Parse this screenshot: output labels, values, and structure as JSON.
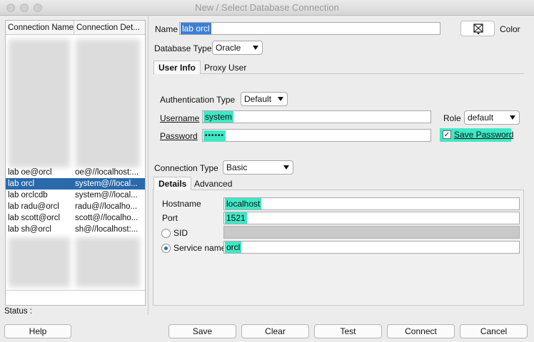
{
  "window": {
    "title": "New / Select Database Connection"
  },
  "connections": {
    "headers": [
      "Connection Name",
      "Connection Det..."
    ],
    "rows": [
      {
        "name": "lab oe@orcl",
        "details": "oe@//localhost:..."
      },
      {
        "name": "lab orcl",
        "details": "system@//local..."
      },
      {
        "name": "lab orclcdb",
        "details": "system@//local..."
      },
      {
        "name": "lab radu@orcl",
        "details": "radu@//localho..."
      },
      {
        "name": "lab scott@orcl",
        "details": "scott@//localho..."
      },
      {
        "name": "lab sh@orcl",
        "details": "sh@//localhost:..."
      }
    ],
    "selected_index": 1
  },
  "status": {
    "label": "Status :"
  },
  "form": {
    "name_label": "Name",
    "name_value": "lab orcl",
    "color_label": "Color",
    "db_type_label": "Database Type",
    "db_type_value": "Oracle",
    "tabs_top": [
      "User Info",
      "Proxy User"
    ],
    "auth_type_label": "Authentication Type",
    "auth_type_value": "Default",
    "username_label": "Username",
    "username_value": "system",
    "role_label": "Role",
    "role_value": "default",
    "password_label": "Password",
    "password_value": "••••••",
    "save_password_label": "Save Password",
    "save_password_checked": true,
    "conn_type_label": "Connection Type",
    "conn_type_value": "Basic",
    "tabs_bottom": [
      "Details",
      "Advanced"
    ],
    "hostname_label": "Hostname",
    "hostname_value": "localhost",
    "port_label": "Port",
    "port_value": "1521",
    "sid_label": "SID",
    "service_name_label": "Service name",
    "service_name_value": "orcl",
    "selected_radio": "service_name"
  },
  "buttons": {
    "help": "Help",
    "save": "Save",
    "clear": "Clear",
    "test": "Test",
    "connect": "Connect",
    "cancel": "Cancel"
  },
  "colors": {
    "highlight": "#3fe8c6",
    "selection": "#2a6aab"
  },
  "icons": {
    "color_picker": "color-swatch-icon"
  }
}
